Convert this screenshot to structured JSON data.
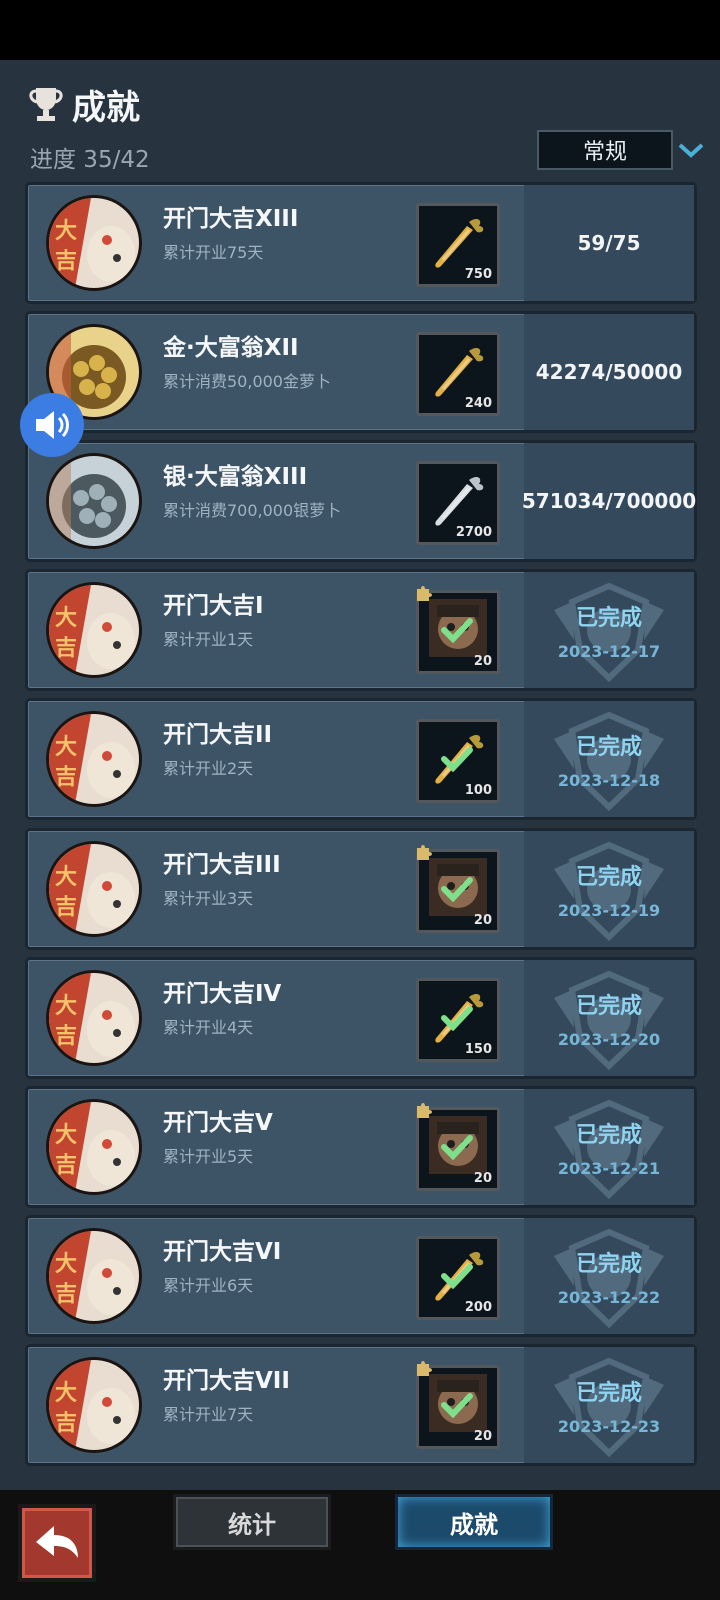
{
  "header": {
    "title": "成就",
    "progress": "进度 35/42",
    "filter": "常规"
  },
  "achievements": [
    {
      "name": "开门大吉XIII",
      "desc": "累计开业75天",
      "reward_qty": "750",
      "reward": "gold-carrot-icon",
      "status": "59/75",
      "avatar": "daji"
    },
    {
      "name": "金·大富翁XII",
      "desc": "累计消费50,000金萝卜",
      "reward_qty": "240",
      "reward": "gold-carrot-icon",
      "status": "42274/50000",
      "avatar": "gold"
    },
    {
      "name": "银·大富翁XIII",
      "desc": "累计消费700,000银萝卜",
      "reward_qty": "2700",
      "reward": "silver-carrot-icon",
      "status": "571034/700000",
      "avatar": "silver"
    },
    {
      "name": "开门大吉I",
      "desc": "累计开业1天",
      "reward_qty": "20",
      "reward": "character-portrait",
      "done": "已完成",
      "date": "2023-12-17",
      "avatar": "daji"
    },
    {
      "name": "开门大吉II",
      "desc": "累计开业2天",
      "reward_qty": "100",
      "reward": "gold-carrot-icon",
      "done": "已完成",
      "date": "2023-12-18",
      "avatar": "daji"
    },
    {
      "name": "开门大吉III",
      "desc": "累计开业3天",
      "reward_qty": "20",
      "reward": "character-portrait",
      "done": "已完成",
      "date": "2023-12-19",
      "avatar": "daji"
    },
    {
      "name": "开门大吉IV",
      "desc": "累计开业4天",
      "reward_qty": "150",
      "reward": "gold-carrot-icon",
      "done": "已完成",
      "date": "2023-12-20",
      "avatar": "daji"
    },
    {
      "name": "开门大吉V",
      "desc": "累计开业5天",
      "reward_qty": "20",
      "reward": "character-portrait",
      "done": "已完成",
      "date": "2023-12-21",
      "avatar": "daji"
    },
    {
      "name": "开门大吉VI",
      "desc": "累计开业6天",
      "reward_qty": "200",
      "reward": "gold-carrot-icon",
      "done": "已完成",
      "date": "2023-12-22",
      "avatar": "daji"
    },
    {
      "name": "开门大吉VII",
      "desc": "累计开业7天",
      "reward_qty": "20",
      "reward": "character-portrait",
      "done": "已完成",
      "date": "2023-12-23",
      "avatar": "daji"
    }
  ],
  "tabs": {
    "stats": "统计",
    "achievements": "成就"
  },
  "colors": {
    "panel": "#27343f",
    "card": "#3d5467",
    "done_text": "#8fd3f0",
    "active_tab": "#1b4a6b"
  }
}
